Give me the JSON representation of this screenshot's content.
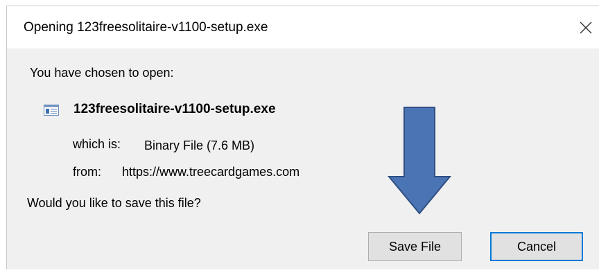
{
  "dialog": {
    "title": "Opening 123freesolitaire-v1100-setup.exe",
    "close_icon": "close-icon",
    "intro": "You have chosen to open:",
    "file": {
      "icon": "executable-file-icon",
      "name": "123freesolitaire-v1100-setup.exe",
      "which_label": "which is:",
      "which_value": "Binary File (7.6 MB)",
      "from_label": "from:",
      "from_value": "https://www.treecardgames.com"
    },
    "question": "Would you like to save this file?",
    "buttons": {
      "save": "Save File",
      "cancel": "Cancel"
    }
  },
  "annotation": {
    "icon": "down-arrow-icon",
    "fill_color": "#4a74b4",
    "stroke_color": "#2f4f82"
  },
  "colors": {
    "dialog_bg": "#f0f0f0",
    "titlebar_bg": "#ffffff",
    "button_bg": "#e1e1e1",
    "focus_border": "#0078d7"
  }
}
